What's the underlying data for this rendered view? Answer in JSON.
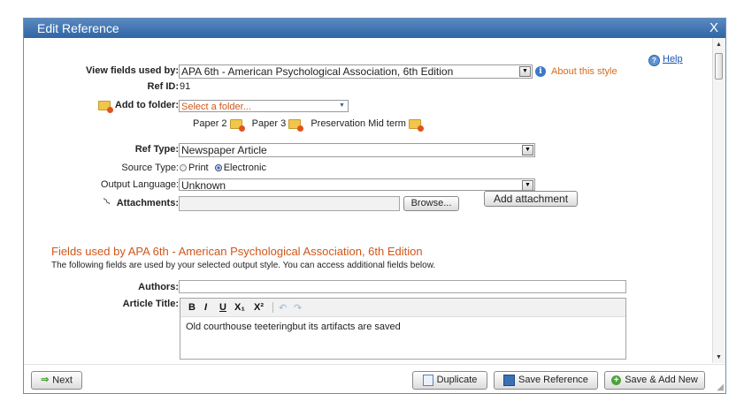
{
  "dialog": {
    "title": "Edit Reference",
    "close_label": "X",
    "help_label": "Help"
  },
  "fields": {
    "view_fields_label": "View fields used by:",
    "view_fields_value": "APA 6th - American Psychological Association, 6th Edition",
    "about_style_label": "About this style",
    "ref_id_label": "Ref ID:",
    "ref_id_value": "91",
    "add_to_folder_label": "Add to folder:",
    "folder_placeholder": "Select a folder...",
    "folders": [
      "Paper 2",
      "Paper 3",
      "Preservation Mid term"
    ],
    "ref_type_label": "Ref Type:",
    "ref_type_value": "Newspaper Article",
    "source_type_label": "Source Type:",
    "source_options": [
      "Print",
      "Electronic"
    ],
    "source_selected": "Electronic",
    "output_language_label": "Output Language:",
    "output_language_value": "Unknown",
    "attachments_label": "Attachments:",
    "browse_label": "Browse...",
    "add_attachment_label": "Add attachment"
  },
  "style_section": {
    "title": "Fields used by APA 6th - American Psychological Association, 6th Edition",
    "description": "The following fields are used by your selected output style. You can access additional fields below.",
    "authors_label": "Authors:",
    "authors_value": "",
    "article_title_label": "Article Title:",
    "article_title_value": "Old courthouse teeteringbut its artifacts are saved",
    "toolbar": {
      "bold": "B",
      "italic": "I",
      "underline": "U",
      "subscript": "X₁",
      "superscript": "X²",
      "undo": "↶",
      "redo": "↷"
    }
  },
  "footer": {
    "next_label": "Next",
    "duplicate_label": "Duplicate",
    "save_label": "Save Reference",
    "save_add_label": "Save & Add New"
  },
  "colors": {
    "titlebar": "#2f65a4",
    "accent_orange": "#d0561b",
    "link_blue": "#1b55b5"
  }
}
